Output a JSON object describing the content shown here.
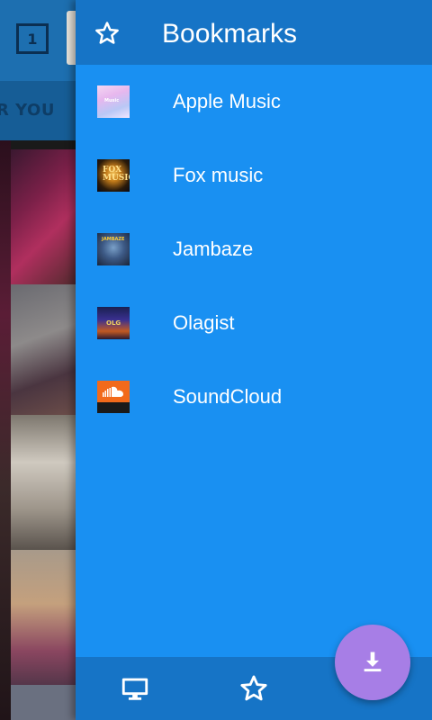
{
  "background": {
    "tab_count": "1",
    "tab_label": "R YOU"
  },
  "drawer": {
    "title": "Bookmarks",
    "header_icon": "star-outline-icon",
    "bookmarks": [
      {
        "label": "Apple Music",
        "thumbnail_text": "Music"
      },
      {
        "label": "Fox music",
        "thumbnail_text": "FOX MUSIC"
      },
      {
        "label": "Jambaze",
        "thumbnail_text": "JAMBAZE"
      },
      {
        "label": "Olagist",
        "thumbnail_text": "OLG"
      },
      {
        "label": "SoundCloud",
        "thumbnail_text": "SoundCloud"
      }
    ]
  },
  "bottom_bar": {
    "items": [
      {
        "icon": "desktop-icon"
      },
      {
        "icon": "star-outline-icon"
      }
    ]
  },
  "fab": {
    "icon": "download-icon"
  },
  "colors": {
    "drawer_bg": "#1990f2",
    "header_bg": "#1674c6",
    "fab_bg": "#a77ee6",
    "text": "#ffffff"
  }
}
